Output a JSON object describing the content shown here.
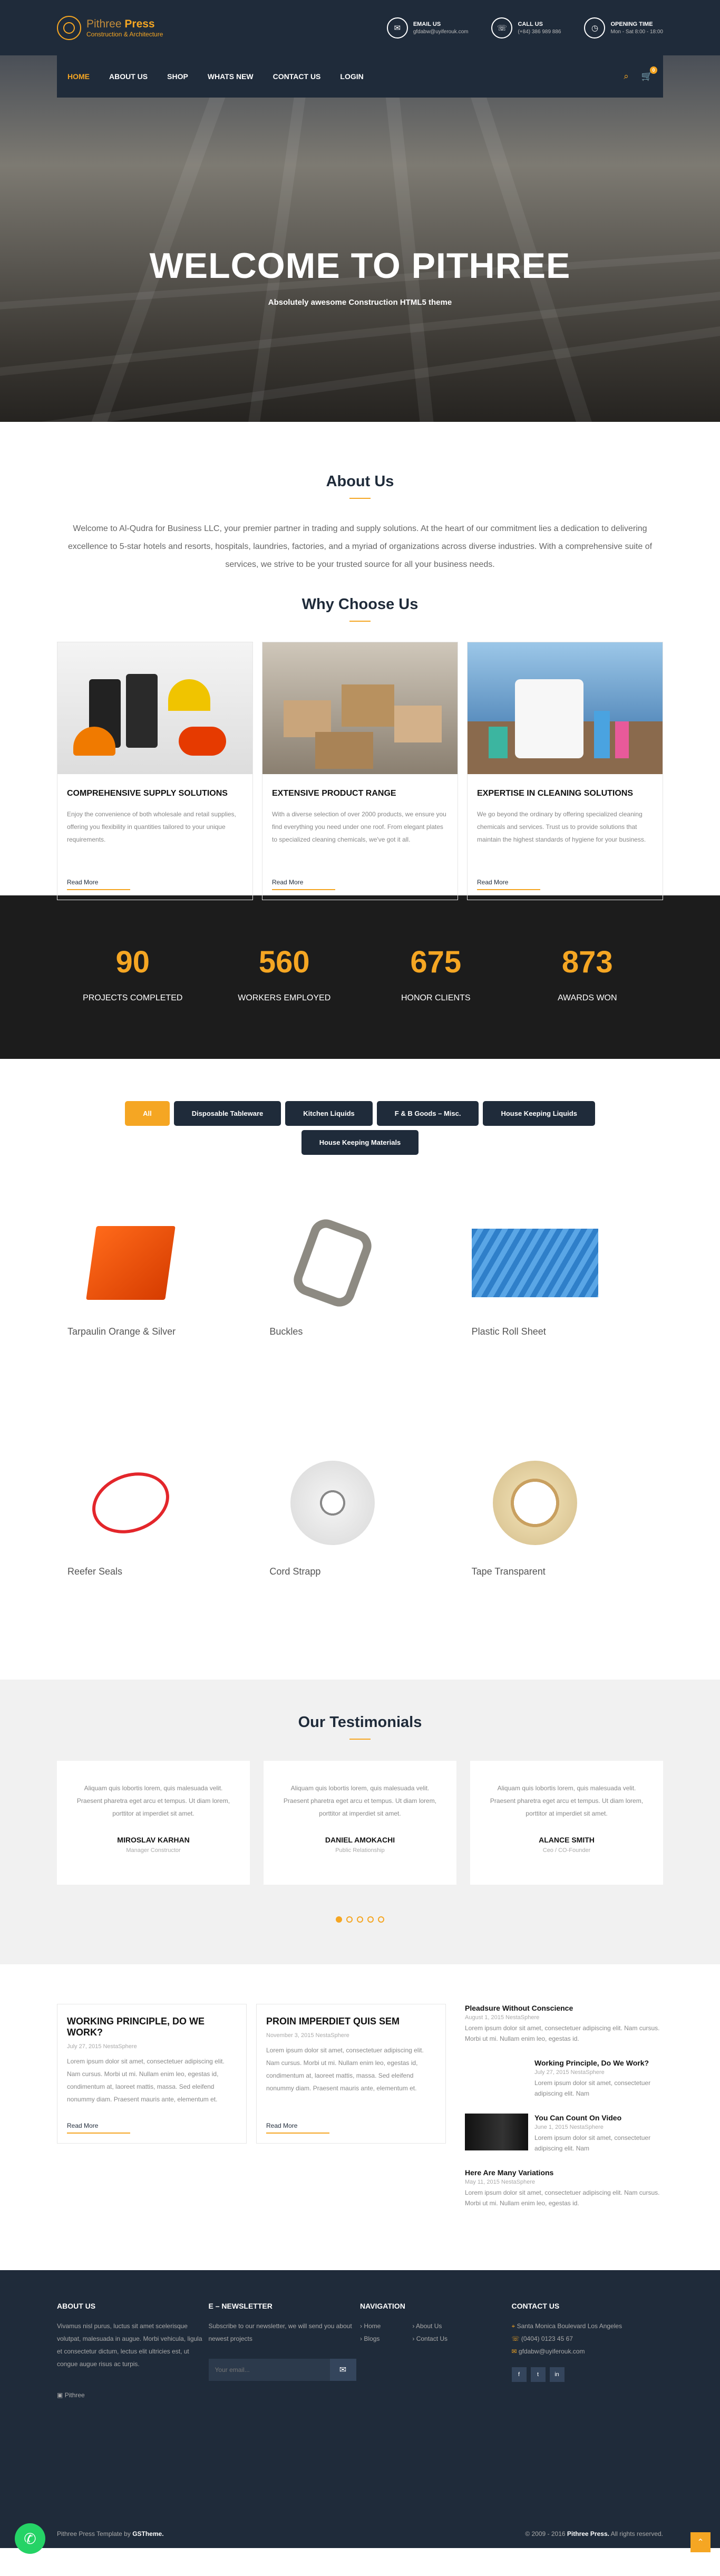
{
  "brand": {
    "name_a": "Pithree",
    "name_b": "Press",
    "tagline": "Construction & Architecture"
  },
  "contacts": [
    {
      "icon": "mail-icon",
      "label": "Email us",
      "value": "gfdabw@uyiferouk.com"
    },
    {
      "icon": "phone-icon",
      "label": "Call us",
      "value": "(+84) 386 989 886"
    },
    {
      "icon": "clock-icon",
      "label": "Opening time",
      "value": "Mon - Sat 8:00 - 18:00"
    }
  ],
  "nav": [
    "HOME",
    "ABOUT US",
    "SHOP",
    "WHATS NEW",
    "CONTACT US",
    "LOGIN"
  ],
  "cart_count": "0",
  "hero": {
    "title": "WELCOME TO PITHREE",
    "subtitle": "Absolutely awesome Construction HTML5 theme"
  },
  "about": {
    "title": "About Us",
    "text": "Welcome to Al-Qudra for Business LLC, your premier partner in trading and supply solutions. At the heart of our commitment lies a dedication to delivering excellence to 5-star hotels and resorts, hospitals, laundries, factories, and a myriad of organizations across diverse industries. With a comprehensive suite of services, we strive to be your trusted source for all your business needs."
  },
  "why": {
    "title": "Why Choose Us",
    "cards": [
      {
        "title": "COMPREHENSIVE SUPPLY SOLUTIONS",
        "text": "Enjoy the convenience of both wholesale and retail supplies, offering you flexibility in quantities tailored to your unique requirements.",
        "link": "Read More"
      },
      {
        "title": "EXTENSIVE PRODUCT RANGE",
        "text": "With a diverse selection of over 2000 products, we ensure you find everything you need under one roof. From elegant plates to specialized cleaning chemicals, we've got it all.",
        "link": "Read More"
      },
      {
        "title": "EXPERTISE IN CLEANING SOLUTIONS",
        "text": "We go beyond the ordinary by offering specialized cleaning chemicals and services. Trust us to provide solutions that maintain the highest standards of hygiene for your business.",
        "link": "Read More"
      }
    ]
  },
  "stats": [
    {
      "n": "90",
      "l": "PROJECTS COMPLETED"
    },
    {
      "n": "560",
      "l": "WORKERS EMPLOYED"
    },
    {
      "n": "675",
      "l": "HONOR CLIENTS"
    },
    {
      "n": "873",
      "l": "AWARDS WON"
    }
  ],
  "filters": [
    "All",
    "Disposable Tableware",
    "Kitchen Liquids",
    "F & B Goods – Misc.",
    "House Keeping Liquids",
    "House Keeping Materials"
  ],
  "products": [
    "Tarpaulin Orange & Silver",
    "Buckles",
    "Plastic Roll Sheet",
    "Reefer Seals",
    "Cord Strapp",
    "Tape Transparent"
  ],
  "testimonials": {
    "title": "Our Testimonials",
    "items": [
      {
        "text": "Aliquam quis lobortis lorem, quis malesuada velit. Praesent pharetra eget arcu et tempus. Ut diam lorem, porttitor at imperdiet sit amet.",
        "name": "MIROSLAV KARHAN",
        "role": "Manager Constructor"
      },
      {
        "text": "Aliquam quis lobortis lorem, quis malesuada velit. Praesent pharetra eget arcu et tempus. Ut diam lorem, porttitor at imperdiet sit amet.",
        "name": "DANIEL AMOKACHI",
        "role": "Public Relationship"
      },
      {
        "text": "Aliquam quis lobortis lorem, quis malesuada velit. Praesent pharetra eget arcu et tempus. Ut diam lorem, porttitor at imperdiet sit amet.",
        "name": "ALANCE SMITH",
        "role": "Ceo / CO-Founder"
      }
    ]
  },
  "blog": [
    {
      "title": "WORKING PRINCIPLE, DO WE WORK?",
      "meta": "July 27, 2015 NestaSphere",
      "text": "Lorem ipsum dolor sit amet, consectetuer adipiscing elit. Nam cursus. Morbi ut mi. Nullam enim leo, egestas id, condimentum at, laoreet mattis, massa. Sed eleifend nonummy diam. Praesent mauris ante, elementum et.",
      "link": "Read More"
    },
    {
      "title": "PROIN IMPERDIET QUIS SEM",
      "meta": "November 3, 2015 NestaSphere",
      "text": "Lorem ipsum dolor sit amet, consectetuer adipiscing elit. Nam cursus. Morbi ut mi. Nullam enim leo, egestas id, condimentum at, laoreet mattis, massa. Sed eleifend nonummy diam. Praesent mauris ante, elementum et.",
      "link": "Read More"
    }
  ],
  "side": [
    {
      "title": "Pleadsure Without Conscience",
      "meta": "August 1, 2015 NestaSphere",
      "text": "Lorem ipsum dolor sit amet, consectetuer adipiscing elit. Nam cursus. Morbi ut mi. Nullam enim leo, egestas id."
    },
    {
      "title": "Working Principle, Do We Work?",
      "meta": "July 27, 2015 NestaSphere",
      "text": "Lorem ipsum dolor sit amet, consectetuer adipiscing elit. Nam"
    },
    {
      "title": "You Can Count On Video",
      "meta": "June 1, 2015 NestaSphere",
      "text": "Lorem ipsum dolor sit amet, consectetuer adipiscing elit. Nam"
    },
    {
      "title": "Here Are Many Variations",
      "meta": "May 11, 2015 NestaSphere",
      "text": "Lorem ipsum dolor sit amet, consectetuer adipiscing elit. Nam cursus. Morbi ut mi. Nullam enim leo, egestas id."
    }
  ],
  "footer": {
    "about_t": "ABOUT US",
    "about_p": "Vivamus nisl purus, luctus sit amet scelerisque volutpat, malesuada in augue. Morbi vehicula, ligula et consectetur dictum, lectus elit ultricies est, ut congue augue risus ac turpis.",
    "news_t": "E – NEWSLETTER",
    "news_p": "Subscribe to our newsletter, we will send you about newest projects",
    "news_ph": "Your email...",
    "nav_t": "NAVIGATION",
    "nav_a": [
      "Home",
      "Blogs"
    ],
    "nav_b": [
      "About Us",
      "Contact Us"
    ],
    "contact_t": "CONTACT US",
    "addr": "Santa Monica Boulevard Los Angeles",
    "phone": "(0404) 0123 45 67",
    "mail": "gfdabw@uyiferouk.com",
    "logo_alt": "Pithree",
    "copy_a": "Pithree Press Template by ",
    "copy_b": "GSTheme.",
    "copy_c": "© 2009 - 2016 ",
    "copy_d": "Pithree Press.",
    "copy_e": " All rights reserved."
  }
}
